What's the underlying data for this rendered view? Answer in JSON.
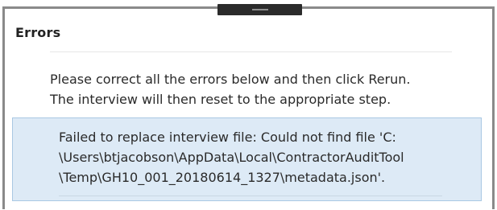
{
  "dialog": {
    "title": "Errors",
    "instructions": [
      "Please correct all the errors below and then click Rerun.",
      "The interview will then reset to the appropriate step."
    ],
    "errors": [
      {
        "lines": [
          "Failed to replace interview file: Could not find file 'C:",
          "\\Users\\btjacobson\\AppData\\Local\\ContractorAuditTool",
          "\\Temp\\GH10_001_20180614_1327\\metadata.json'."
        ]
      }
    ]
  }
}
